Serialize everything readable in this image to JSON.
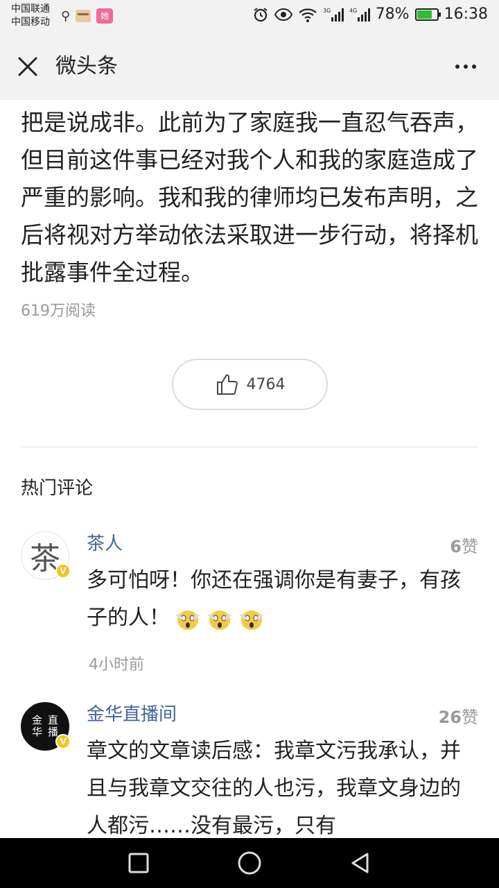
{
  "status_bar": {
    "carrier1": "中国联通",
    "carrier2": "中国移动",
    "app_icon_label": "她",
    "battery": "78%",
    "battery_level": 0.78,
    "time": "16:38"
  },
  "title_bar": {
    "title": "微头条"
  },
  "article": {
    "paragraph": "把是说成非。此前为了家庭我一直忍气吞声，但目前这件事已经对我个人和我的家庭造成了严重的影响。我和我的律师均已发布声明，之后将视对方举动依法采取进一步行动，将择机批露事件全过程。",
    "read_count": "619万阅读",
    "like_count": "4764"
  },
  "comments_section": {
    "title": "热门评论",
    "comments": [
      {
        "name": "茶人",
        "avatar_char": "茶",
        "likes_num": "6",
        "likes_unit": "赞",
        "text": "多可怕呀！你还在强调你是有妻子，有孩子的人！",
        "time": "4小时前"
      },
      {
        "name": "金华直播间",
        "avatar_char1": "金",
        "avatar_char2": "华",
        "avatar_char3": "直",
        "avatar_char4": "播",
        "likes_num": "26",
        "likes_unit": "赞",
        "text": "章文的文章读后感：我章文污我承认，并且与我章文交往的人也污，我章文身边的人都污……没有最污，只有"
      }
    ]
  },
  "colors": {
    "name_blue": "#406599",
    "muted_gray": "#999999",
    "badge_yellow": "#f5c518"
  }
}
